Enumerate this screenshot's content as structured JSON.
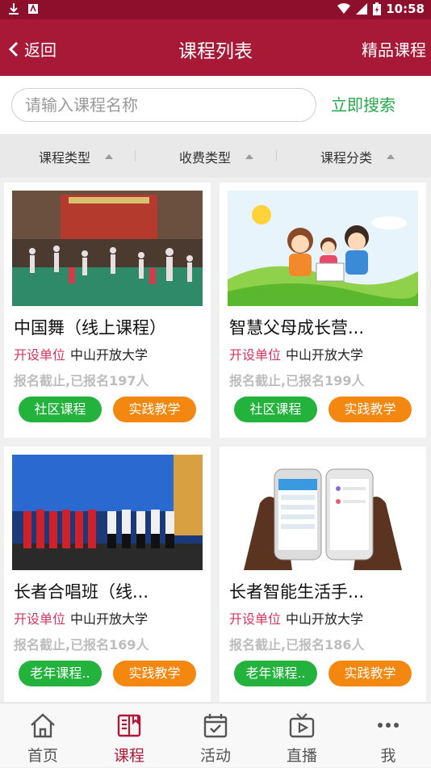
{
  "status_bar": {
    "time": "10:58"
  },
  "header": {
    "back_label": "返回",
    "title": "课程列表",
    "right_link": "精品课程"
  },
  "search": {
    "placeholder": "请输入课程名称",
    "value": "",
    "button": "立即搜索"
  },
  "filters": [
    {
      "label": "课程类型"
    },
    {
      "label": "收费类型"
    },
    {
      "label": "课程分类"
    }
  ],
  "unit_label": "开设单位",
  "courses": [
    {
      "title": "中国舞（线上课程）",
      "unit": "中山开放大学",
      "status": "报名截止,已报名197人",
      "tag1": "社区课程",
      "tag2": "实践教学",
      "image": "dance-class-photo"
    },
    {
      "title": "智慧父母成长营...",
      "unit": "中山开放大学",
      "status": "报名截止,已报名199人",
      "tag1": "社区课程",
      "tag2": "实践教学",
      "image": "family-cartoon-illustration"
    },
    {
      "title": "长者合唱班（线...",
      "unit": "中山开放大学",
      "status": "报名截止,已报名169人",
      "tag1": "老年课程..",
      "tag2": "实践教学",
      "image": "choir-stage-photo"
    },
    {
      "title": "长者智能生活手...",
      "unit": "中山开放大学",
      "status": "报名截止,已报名186人",
      "tag1": "老年课程..",
      "tag2": "实践教学",
      "image": "hands-holding-phones-photo"
    }
  ],
  "tabs": [
    {
      "label": "首页",
      "icon": "home-icon",
      "active": false
    },
    {
      "label": "课程",
      "icon": "book-icon",
      "active": true
    },
    {
      "label": "活动",
      "icon": "calendar-check-icon",
      "active": false
    },
    {
      "label": "直播",
      "icon": "tv-play-icon",
      "active": false
    },
    {
      "label": "我",
      "icon": "more-dots-icon",
      "active": false
    }
  ],
  "colors": {
    "header": "#a71937",
    "status_bar": "#8e0f2c",
    "accent_green": "#23b23c",
    "accent_orange": "#f48710",
    "unit_label": "#d8345f",
    "search_button": "#27a84a"
  }
}
